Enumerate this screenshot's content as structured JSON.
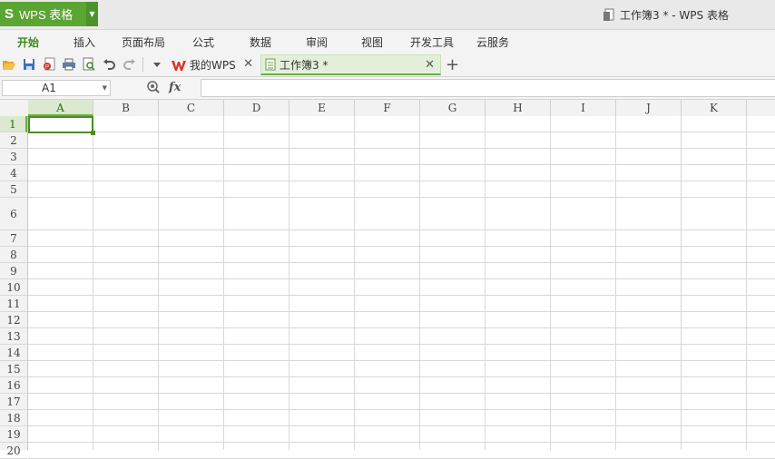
{
  "app": {
    "logo_letter": "S",
    "name": "WPS 表格",
    "window_title": "工作簿3 * - WPS 表格",
    "accent_color": "#5ba533"
  },
  "menu": {
    "items": [
      "开始",
      "插入",
      "页面布局",
      "公式",
      "数据",
      "审阅",
      "视图",
      "开发工具",
      "云服务"
    ],
    "active_index": 0
  },
  "toolbar": {
    "icons": [
      "open-folder-icon",
      "save-icon",
      "export-pdf-icon",
      "print-icon",
      "print-preview-icon",
      "undo-icon",
      "redo-icon",
      "dropdown-icon"
    ]
  },
  "tabs": [
    {
      "label": "我的WPS",
      "icon": "wps-logo-icon",
      "active": false
    },
    {
      "label": "工作簿3 *",
      "icon": "spreadsheet-doc-icon",
      "active": true
    }
  ],
  "formula_bar": {
    "name_box": "A1",
    "fx_label": "fx",
    "formula": ""
  },
  "sheet": {
    "columns": [
      "A",
      "B",
      "C",
      "D",
      "E",
      "F",
      "G",
      "H",
      "I",
      "J",
      "K"
    ],
    "rows": [
      "1",
      "2",
      "3",
      "4",
      "5",
      "6",
      "7",
      "8",
      "9",
      "10",
      "11",
      "12",
      "13",
      "14",
      "15",
      "16",
      "17",
      "18",
      "19",
      "20"
    ],
    "selected_cell": "A1"
  }
}
